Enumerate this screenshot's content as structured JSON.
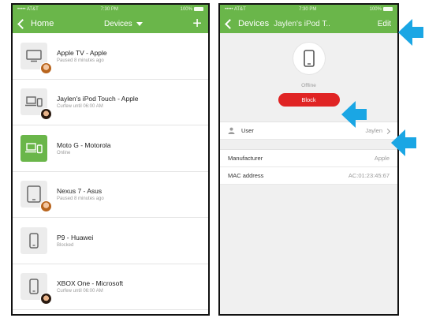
{
  "colors": {
    "brand_green": "#6ab64a",
    "block_red": "#e02424",
    "arrow_blue": "#1aa6e4"
  },
  "left_screen": {
    "status": {
      "carrier": "••••• AT&T",
      "time": "7:30 PM",
      "battery": "100%"
    },
    "nav": {
      "back_label": "Home",
      "title": "Devices",
      "add_icon": "plus-icon"
    },
    "devices": [
      {
        "name": "Apple TV - Apple",
        "status": "Paused 8 minutes ago",
        "icon": "tv-icon",
        "active": false,
        "avatar": "girl"
      },
      {
        "name": "Jaylen's iPod Touch - Apple",
        "status": "Curfew until 06:00 AM",
        "icon": "laptop-phone-icon",
        "active": false,
        "avatar": "boy"
      },
      {
        "name": "Moto G - Motorola",
        "status": "Online",
        "icon": "laptop-phone-icon",
        "active": true,
        "avatar": null
      },
      {
        "name": "Nexus 7 - Asus",
        "status": "Paused 8 minutes ago",
        "icon": "tablet-icon",
        "active": false,
        "avatar": "girl"
      },
      {
        "name": "P9 - Huawei",
        "status": "Blocked",
        "icon": "phone-icon",
        "active": false,
        "avatar": null
      },
      {
        "name": "XBOX One - Microsoft",
        "status": "Curfew until 06:00 AM",
        "icon": "phone-icon",
        "active": false,
        "avatar": "boy"
      }
    ]
  },
  "right_screen": {
    "status": {
      "carrier": "••••• AT&T",
      "time": "7:30 PM",
      "battery": "100%"
    },
    "nav": {
      "back_label": "Devices",
      "title": "Jaylen's iPod T..",
      "edit_label": "Edit"
    },
    "device_status": "Offline",
    "block_label": "Block",
    "user_row": {
      "label": "User",
      "value": "Jaylen"
    },
    "details": [
      {
        "label": "Manufacturer",
        "value": "Apple"
      },
      {
        "label": "MAC address",
        "value": "AC:01:23:45:67"
      }
    ]
  }
}
